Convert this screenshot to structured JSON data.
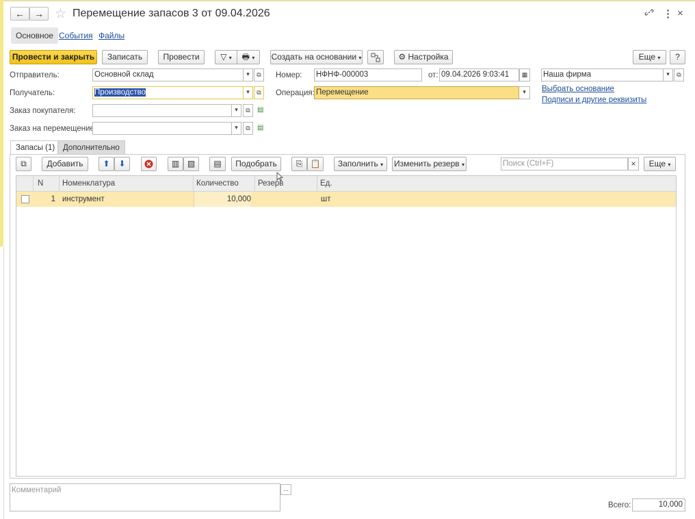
{
  "window": {
    "title": "Перемещение запасов 3 от 09.04.2026",
    "back_glyph": "←",
    "forward_glyph": "→",
    "star_glyph": "☆",
    "link_glyph": "🔗",
    "more_glyph": "⋮",
    "close_glyph": "×"
  },
  "tabs": [
    {
      "label": "Основное",
      "active": true
    },
    {
      "label": "События"
    },
    {
      "label": "Файлы"
    }
  ],
  "toolbar": {
    "post_close": "Провести и закрыть",
    "save": "Записать",
    "post": "Провести",
    "filter_glyph": "▽",
    "print_glyph": "🖶",
    "create_based": "Создать на основании",
    "settings": "Настройка",
    "more": "Еще",
    "help": "?"
  },
  "form": {
    "sender_label": "Отправитель:",
    "sender_value": "Основной склад",
    "receiver_label": "Получатель:",
    "receiver_value": "Производство",
    "customer_order_label": "Заказ покупателя:",
    "customer_order_value": "",
    "transfer_order_label": "Заказ на перемещение:",
    "transfer_order_value": "",
    "number_label": "Номер:",
    "number_value": "НФНФ-000003",
    "date_label": "от:",
    "date_value": "09.04.2026  9:03:41",
    "operation_label": "Операция:",
    "operation_value": "Перемещение",
    "company_value": "Наша фирма",
    "choose_basis": "Выбрать основание",
    "signatures": "Подписи и другие реквизиты"
  },
  "subtabs": [
    {
      "label": "Запасы (1)",
      "active": true
    },
    {
      "label": "Дополнительно"
    }
  ],
  "table_toolbar": {
    "add": "Добавить",
    "pick": "Подобрать",
    "fill": "Заполнить",
    "change_reserve": "Изменить резерв",
    "search_placeholder": "Поиск (Ctrl+F)",
    "clear": "×",
    "more": "Еще"
  },
  "table": {
    "columns": [
      "N",
      "Номенклатура",
      "Количество",
      "Резерв",
      "Ед."
    ],
    "rows": [
      {
        "n": "1",
        "item": "инструмент",
        "qty": "10,000",
        "reserve": "",
        "unit": "шт"
      }
    ]
  },
  "footer": {
    "comment_placeholder": "Комментарий",
    "comment_btn": "...",
    "total_label": "Всего:",
    "total_value": "10,000"
  },
  "colors": {
    "accent": "#f2c21b",
    "selected_row": "#fbe9b0",
    "link": "#1c4e97"
  }
}
